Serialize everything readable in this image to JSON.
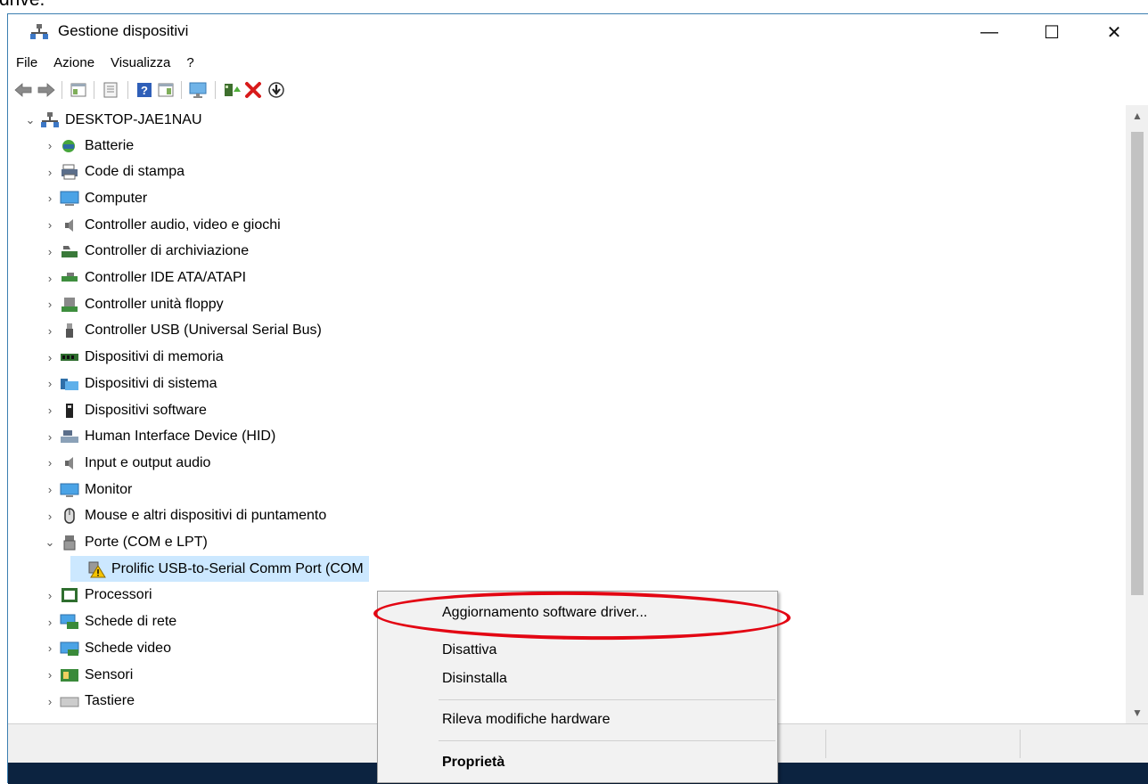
{
  "top_text": "drive.",
  "window": {
    "title": "Gestione dispositivi",
    "controls": {
      "minimize": "—",
      "maximize": "☐",
      "close": "✕"
    }
  },
  "menu": [
    "File",
    "Azione",
    "Visualizza",
    "?"
  ],
  "tree": {
    "root": "DESKTOP-JAE1NAU",
    "items": [
      {
        "label": "Batterie",
        "icon": "battery-icon"
      },
      {
        "label": "Code di stampa",
        "icon": "printer-icon"
      },
      {
        "label": "Computer",
        "icon": "computer-icon"
      },
      {
        "label": "Controller audio, video e giochi",
        "icon": "speaker-icon"
      },
      {
        "label": "Controller di archiviazione",
        "icon": "storage-icon"
      },
      {
        "label": "Controller IDE ATA/ATAPI",
        "icon": "ide-icon"
      },
      {
        "label": "Controller unità floppy",
        "icon": "floppy-icon"
      },
      {
        "label": "Controller USB (Universal Serial Bus)",
        "icon": "usb-icon"
      },
      {
        "label": "Dispositivi di memoria",
        "icon": "memory-icon"
      },
      {
        "label": "Dispositivi di sistema",
        "icon": "system-folder-icon"
      },
      {
        "label": "Dispositivi software",
        "icon": "software-device-icon"
      },
      {
        "label": "Human Interface Device (HID)",
        "icon": "hid-icon"
      },
      {
        "label": "Input e output audio",
        "icon": "speaker-icon"
      },
      {
        "label": "Monitor",
        "icon": "monitor-icon"
      },
      {
        "label": "Mouse e altri dispositivi di puntamento",
        "icon": "mouse-icon"
      },
      {
        "label": "Porte (COM e LPT)",
        "icon": "port-icon"
      },
      {
        "label": "Prolific USB-to-Serial Comm Port (COM",
        "icon": "warning-port-icon"
      },
      {
        "label": "Processori",
        "icon": "processor-icon"
      },
      {
        "label": "Schede di rete",
        "icon": "network-icon"
      },
      {
        "label": "Schede video",
        "icon": "video-card-icon"
      },
      {
        "label": "Sensori",
        "icon": "sensor-icon"
      },
      {
        "label": "Tastiere",
        "icon": "keyboard-icon"
      }
    ]
  },
  "context_menu": {
    "update": "Aggiornamento software driver...",
    "disable": "Disattiva",
    "uninstall": "Disinstalla",
    "scan": "Rileva modifiche hardware",
    "properties": "Proprietà"
  },
  "colors": {
    "highlight": "#e30613",
    "selection": "#cce8ff",
    "title_border": "#3c7fb1"
  }
}
